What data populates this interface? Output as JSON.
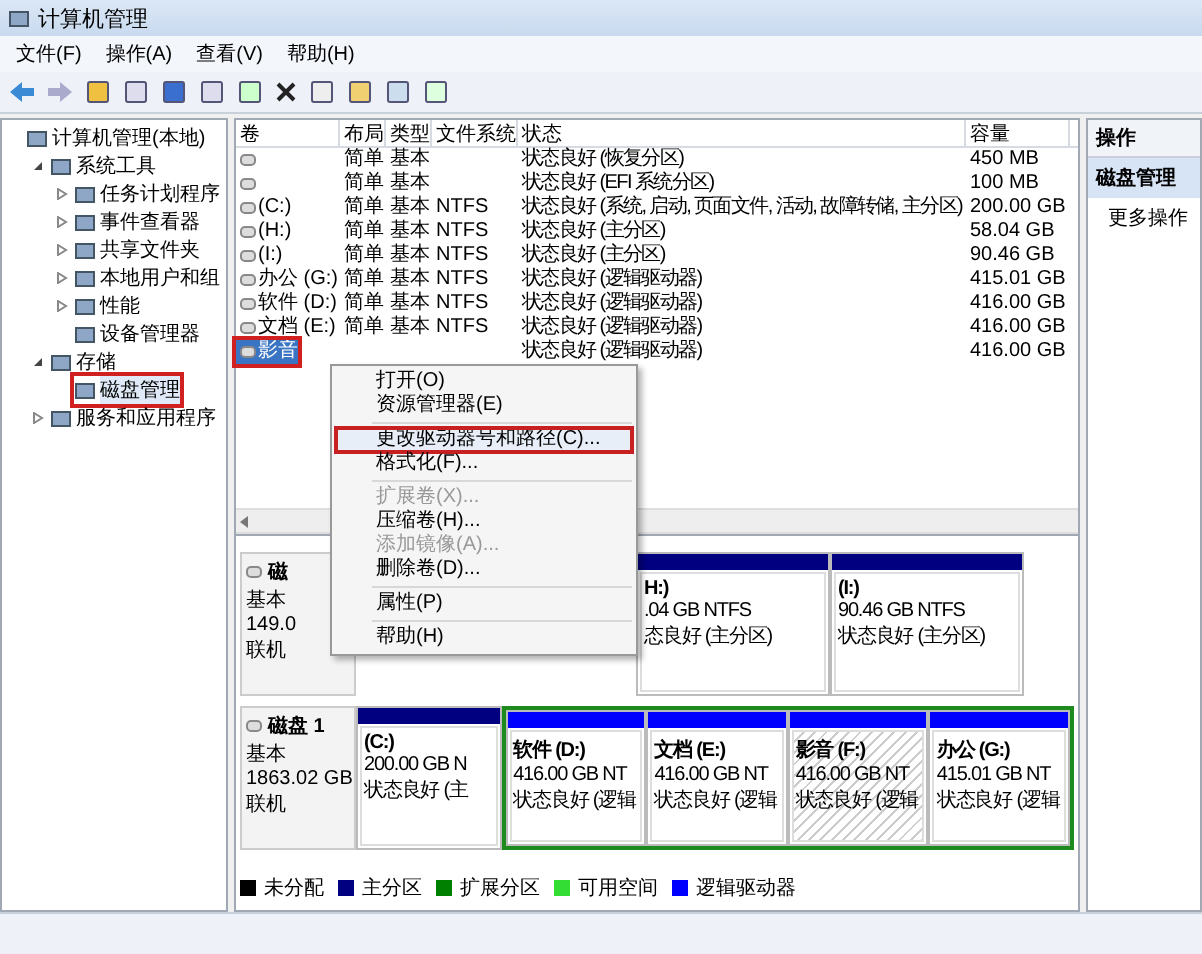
{
  "window": {
    "title": "计算机管理"
  },
  "menu": [
    "文件(F)",
    "操作(A)",
    "查看(V)",
    "帮助(H)"
  ],
  "tree": [
    {
      "label": "计算机管理(本地)",
      "children": [
        {
          "label": "系统工具",
          "expanded": true,
          "children": [
            {
              "label": "任务计划程序",
              "expanded": false
            },
            {
              "label": "事件查看器",
              "expanded": false
            },
            {
              "label": "共享文件夹",
              "expanded": false
            },
            {
              "label": "本地用户和组",
              "expanded": false
            },
            {
              "label": "性能",
              "expanded": false
            },
            {
              "label": "设备管理器"
            }
          ]
        },
        {
          "label": "存储",
          "expanded": true,
          "children": [
            {
              "label": "磁盘管理",
              "selected": true,
              "highlighted": true
            }
          ]
        },
        {
          "label": "服务和应用程序",
          "expanded": false
        }
      ]
    }
  ],
  "volumes": {
    "columns": [
      "卷",
      "布局",
      "类型",
      "文件系统",
      "状态",
      "容量"
    ],
    "rows": [
      {
        "layout": "简单",
        "type": "基本",
        "status": "状态良好 (恢复分区)",
        "capacity": "450 MB",
        "selected": false
      },
      {
        "layout": "简单",
        "type": "基本",
        "status": "状态良好 (EFI 系统分区)",
        "capacity": "100 MB",
        "selected": false
      },
      {
        "volume": "(C:)",
        "layout": "简单",
        "type": "基本",
        "fs": "NTFS",
        "status": "状态良好 (系统, 启动, 页面文件, 活动, 故障转储, 主分区)",
        "capacity": "200.00 GB",
        "selected": false
      },
      {
        "volume": "(H:)",
        "layout": "简单",
        "type": "基本",
        "fs": "NTFS",
        "status": "状态良好 (主分区)",
        "capacity": "58.04 GB",
        "selected": false
      },
      {
        "volume": "(I:)",
        "layout": "简单",
        "type": "基本",
        "fs": "NTFS",
        "status": "状态良好 (主分区)",
        "capacity": "90.46 GB",
        "selected": false
      },
      {
        "volume": "办公 (G:)",
        "layout": "简单",
        "type": "基本",
        "fs": "NTFS",
        "status": "状态良好 (逻辑驱动器)",
        "capacity": "415.01 GB",
        "selected": false
      },
      {
        "volume": "软件 (D:)",
        "layout": "简单",
        "type": "基本",
        "fs": "NTFS",
        "status": "状态良好 (逻辑驱动器)",
        "capacity": "416.00 GB",
        "selected": false
      },
      {
        "volume": "文档 (E:)",
        "layout": "简单",
        "type": "基本",
        "fs": "NTFS",
        "status": "状态良好 (逻辑驱动器)",
        "capacity": "416.00 GB",
        "selected": false
      },
      {
        "volume": "影音",
        "status": "状态良好 (逻辑驱动器)",
        "capacity": "416.00 GB",
        "selected": true,
        "highlighted": true
      }
    ]
  },
  "context_menu": [
    [
      {
        "label": "打开(O)",
        "disabled": false,
        "highlighted": false
      },
      {
        "label": "资源管理器(E)",
        "disabled": false,
        "highlighted": false
      }
    ],
    [
      {
        "label": "更改驱动器号和路径(C)...",
        "disabled": false,
        "highlighted": true
      },
      {
        "label": "格式化(F)...",
        "disabled": false,
        "highlighted": false
      }
    ],
    [
      {
        "label": "扩展卷(X)...",
        "disabled": true,
        "highlighted": false
      },
      {
        "label": "压缩卷(H)...",
        "disabled": false,
        "highlighted": false
      },
      {
        "label": "添加镜像(A)...",
        "disabled": true,
        "highlighted": false
      },
      {
        "label": "删除卷(D)...",
        "disabled": false,
        "highlighted": false
      }
    ],
    [
      {
        "label": "属性(P)",
        "disabled": false,
        "highlighted": false
      }
    ],
    [
      {
        "label": "帮助(H)",
        "disabled": false,
        "highlighted": false
      }
    ]
  ],
  "disks": [
    {
      "name": "磁",
      "type": "基本",
      "size": "149.0",
      "status": "联机",
      "partitions": [
        {
          "name": "H:)",
          "size": ".04 GB NTFS",
          "status": "态良好 (主分区)",
          "color": "#000080",
          "selected": false
        },
        {
          "name": "(I:)",
          "size": "90.46 GB NTFS",
          "status": "状态良好 (主分区)",
          "color": "#000080",
          "selected": false
        }
      ]
    },
    {
      "name": "磁盘 1",
      "type": "基本",
      "size": "1863.02 GB",
      "status": "联机",
      "partitions": [
        {
          "name": "(C:)",
          "size": "200.00 GB N",
          "status": "状态良好 (主",
          "color": "#000080",
          "selected": false
        }
      ],
      "extended_partition": [
        {
          "name": "软件 (D:)",
          "size": "416.00 GB NT",
          "status": "状态良好 (逻辑",
          "color": "#0000ff",
          "selected": false
        },
        {
          "name": "文档 (E:)",
          "size": "416.00 GB NT",
          "status": "状态良好 (逻辑",
          "color": "#0000ff",
          "selected": false
        },
        {
          "name": "影音 (F:)",
          "size": "416.00 GB NT",
          "status": "状态良好 (逻辑",
          "color": "#0000ff",
          "selected": true
        },
        {
          "name": "办公 (G:)",
          "size": "415.01 GB NT",
          "status": "状态良好 (逻辑",
          "color": "#0000ff",
          "selected": false
        }
      ]
    }
  ],
  "legend": [
    {
      "label": "未分配",
      "color": "#000000"
    },
    {
      "label": "主分区",
      "color": "#000080"
    },
    {
      "label": "扩展分区",
      "color": "#008000"
    },
    {
      "label": "可用空间",
      "color": "#33dd33"
    },
    {
      "label": "逻辑驱动器",
      "color": "#0000ff"
    }
  ],
  "actions": {
    "title": "操作",
    "items": [
      {
        "label": "磁盘管理",
        "selected": true
      },
      {
        "label": "更多操作",
        "selected": false
      }
    ]
  }
}
